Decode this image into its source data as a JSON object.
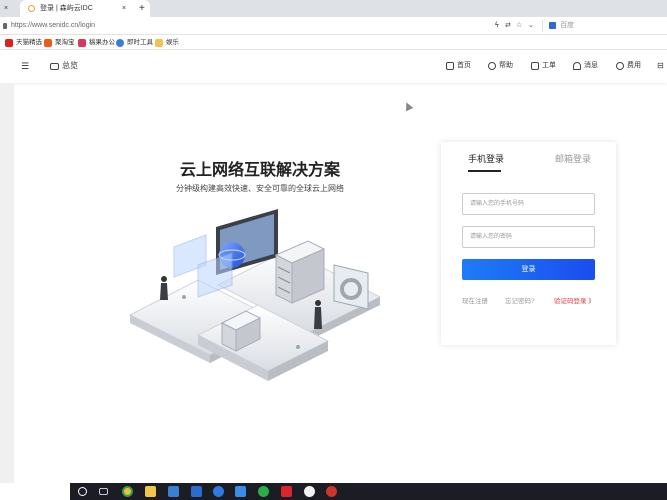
{
  "browser": {
    "tab_close": "×",
    "tab_title": "登录 | 森屿云IDC",
    "tab_close_active": "×",
    "new_tab": "+",
    "url": "https://www.senidc.cn/login",
    "search_placeholder": "百度",
    "bookmarks": [
      {
        "label": "天猫精选",
        "color": "#e02020"
      },
      {
        "label": "聚淘宝",
        "color": "#f25a1d"
      },
      {
        "label": "稿果办公",
        "color": "#d63a5a"
      },
      {
        "label": "即时工具",
        "color": "#3a7be0"
      },
      {
        "label": "娱乐",
        "color": "#f2c14e"
      }
    ]
  },
  "header": {
    "overview": "总览",
    "items": [
      "首页",
      "帮助",
      "工单",
      "消息",
      "费用"
    ]
  },
  "hero": {
    "title": "云上网络互联解决方案",
    "subtitle": "分钟级构建高效快速、安全可靠的全球云上网络"
  },
  "login": {
    "tab_phone": "手机登录",
    "tab_email": "邮箱登录",
    "phone_placeholder": "请输入您的手机号码",
    "password_placeholder": "请输入您的密码",
    "submit": "登录",
    "register": "现在注册",
    "forgot": "忘记密码?",
    "code_login": "验证码登录 》"
  },
  "colors": {
    "primary": "#1a5cf2",
    "accent_link": "#e04040"
  }
}
